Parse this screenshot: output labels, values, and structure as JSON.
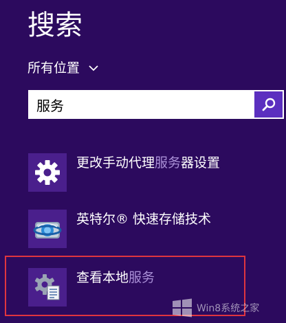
{
  "header": {
    "title": "搜索"
  },
  "scope": {
    "label": "所有位置",
    "icon": "chevron-down-icon"
  },
  "search": {
    "value": "服务",
    "button_icon": "search-icon"
  },
  "results": [
    {
      "prefix": "更改手动代理",
      "match": "服务",
      "suffix": "器设置",
      "icon": "gear-icon"
    },
    {
      "prefix": "英特尔® 快速存储技术",
      "match": "",
      "suffix": "",
      "icon": "intel-rst-icon"
    },
    {
      "prefix": "查看本地",
      "match": "服务",
      "suffix": "",
      "icon": "services-icon"
    }
  ],
  "annotation": {
    "color": "#e0353f"
  },
  "watermark": {
    "text": "Win8系统之家",
    "icon": "windows-logo-icon"
  },
  "colors": {
    "background": "#2c0a5e",
    "tile": "#4a1f8c",
    "accent": "#5b2fbf",
    "match_text": "#a98fd6"
  }
}
